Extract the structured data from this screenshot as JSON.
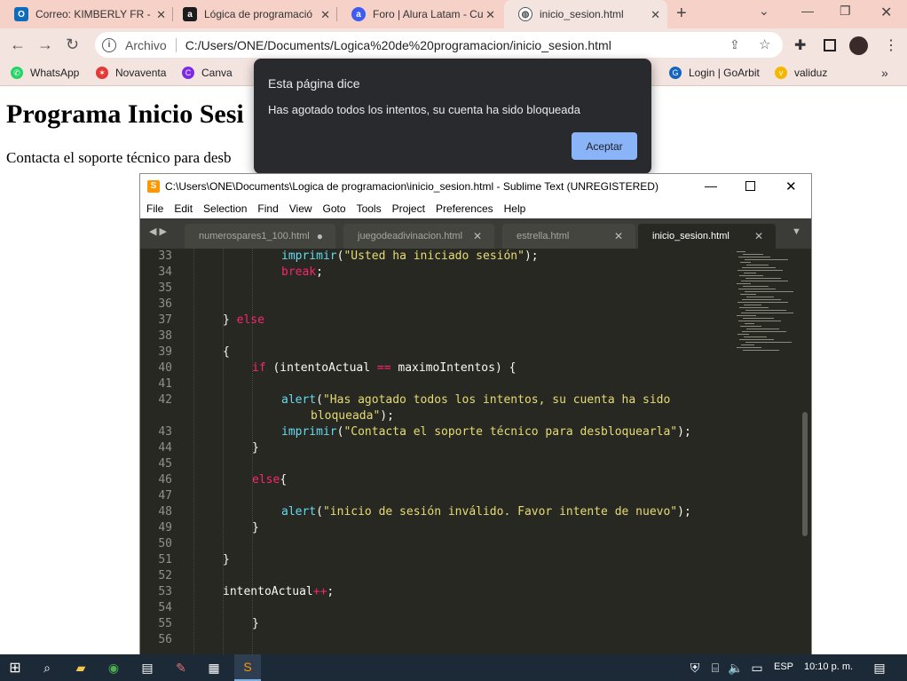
{
  "browser": {
    "tabs": [
      {
        "title": "Correo: KIMBERLY FR -",
        "icon": "outlook-icon",
        "color": "#0f6cbd"
      },
      {
        "title": "Lógica de programació",
        "icon": "alura-icon",
        "color": "#1c1c1c"
      },
      {
        "title": "Foro | Alura Latam - Cu",
        "icon": "alura-forum-icon",
        "color": "#3d5af1"
      },
      {
        "title": "inicio_sesion.html",
        "icon": "globe-icon",
        "color": "#555"
      }
    ],
    "address": {
      "label": "Archivo",
      "url": "C:/Users/ONE/Documents/Logica%20de%20programacion/inicio_sesion.html"
    },
    "bookmarks": [
      {
        "label": "WhatsApp",
        "color": "#25d366"
      },
      {
        "label": "Novaventa",
        "color": "#e53935"
      },
      {
        "label": "Canva",
        "color": "#7d2ae8"
      },
      {
        "label": "Login | GoArbit",
        "color": "#1565c0"
      },
      {
        "label": "validuz",
        "color": "#f5b800"
      }
    ]
  },
  "page": {
    "heading": "Programa Inicio Sesi",
    "paragraph": "Contacta el soporte técnico para desb"
  },
  "dialog": {
    "title": "Esta página dice",
    "message": "Has agotado todos los intentos, su cuenta ha sido bloqueada",
    "ok_label": "Aceptar"
  },
  "sublime": {
    "title": "C:\\Users\\ONE\\Documents\\Logica de programacion\\inicio_sesion.html - Sublime Text (UNREGISTERED)",
    "menu": [
      "File",
      "Edit",
      "Selection",
      "Find",
      "View",
      "Goto",
      "Tools",
      "Project",
      "Preferences",
      "Help"
    ],
    "tabs": [
      {
        "name": "numerospares1_100.html",
        "close": "●"
      },
      {
        "name": "juegodeadivinacion.html",
        "close": "✕"
      },
      {
        "name": "estrella.html",
        "close": "✕"
      },
      {
        "name": "inicio_sesion.html",
        "close": "✕"
      }
    ],
    "lines": [
      {
        "n": "33",
        "indent": 3,
        "tokens": [
          [
            "fn",
            "imprimir"
          ],
          [
            "p",
            "("
          ],
          [
            "st",
            "\"Usted ha iniciado sesión\""
          ],
          [
            "p",
            ");"
          ]
        ]
      },
      {
        "n": "34",
        "indent": 3,
        "tokens": [
          [
            "kw",
            "break"
          ],
          [
            "p",
            ";"
          ]
        ]
      },
      {
        "n": "35",
        "indent": 0,
        "tokens": []
      },
      {
        "n": "36",
        "indent": 0,
        "tokens": []
      },
      {
        "n": "37",
        "indent": 1,
        "tokens": [
          [
            "p",
            "} "
          ],
          [
            "kw",
            "else"
          ]
        ]
      },
      {
        "n": "38",
        "indent": 0,
        "tokens": []
      },
      {
        "n": "39",
        "indent": 1,
        "tokens": [
          [
            "p",
            "{"
          ]
        ]
      },
      {
        "n": "40",
        "indent": 2,
        "tokens": [
          [
            "kw",
            "if"
          ],
          [
            "p",
            " (intentoActual "
          ],
          [
            "kw",
            "=="
          ],
          [
            "p",
            " maximoIntentos) {"
          ]
        ]
      },
      {
        "n": "41",
        "indent": 0,
        "tokens": []
      },
      {
        "n": "42",
        "indent": 3,
        "tokens": [
          [
            "fn",
            "alert"
          ],
          [
            "p",
            "("
          ],
          [
            "st",
            "\"Has agotado todos los intentos, su cuenta ha sido"
          ]
        ]
      },
      {
        "n": "",
        "indent": 4,
        "tokens": [
          [
            "st",
            "bloqueada\""
          ],
          [
            "p",
            ");"
          ]
        ]
      },
      {
        "n": "43",
        "indent": 3,
        "tokens": [
          [
            "fn",
            "imprimir"
          ],
          [
            "p",
            "("
          ],
          [
            "st",
            "\"Contacta el soporte técnico para desbloquearla\""
          ],
          [
            "p",
            ");"
          ]
        ]
      },
      {
        "n": "44",
        "indent": 2,
        "tokens": [
          [
            "p",
            "}"
          ]
        ]
      },
      {
        "n": "45",
        "indent": 0,
        "tokens": []
      },
      {
        "n": "46",
        "indent": 2,
        "tokens": [
          [
            "kw",
            "else"
          ],
          [
            "p",
            "{"
          ]
        ]
      },
      {
        "n": "47",
        "indent": 0,
        "tokens": []
      },
      {
        "n": "48",
        "indent": 3,
        "tokens": [
          [
            "fn",
            "alert"
          ],
          [
            "p",
            "("
          ],
          [
            "st",
            "\"inicio de sesión inválido. Favor intente de nuevo\""
          ],
          [
            "p",
            ");"
          ]
        ]
      },
      {
        "n": "49",
        "indent": 2,
        "tokens": [
          [
            "p",
            "}"
          ]
        ]
      },
      {
        "n": "50",
        "indent": 0,
        "tokens": []
      },
      {
        "n": "51",
        "indent": 1,
        "tokens": [
          [
            "p",
            "}"
          ]
        ]
      },
      {
        "n": "52",
        "indent": 0,
        "tokens": []
      },
      {
        "n": "53",
        "indent": 1,
        "tokens": [
          [
            "p",
            "intentoActual"
          ],
          [
            "kw",
            "++"
          ],
          [
            "p",
            ";"
          ]
        ]
      },
      {
        "n": "54",
        "indent": 0,
        "tokens": []
      },
      {
        "n": "55",
        "indent": 2,
        "tokens": [
          [
            "p",
            "}"
          ]
        ]
      },
      {
        "n": "56",
        "indent": 0,
        "tokens": []
      }
    ]
  },
  "taskbar": {
    "language": "ESP",
    "time": "10:10 p. m."
  }
}
